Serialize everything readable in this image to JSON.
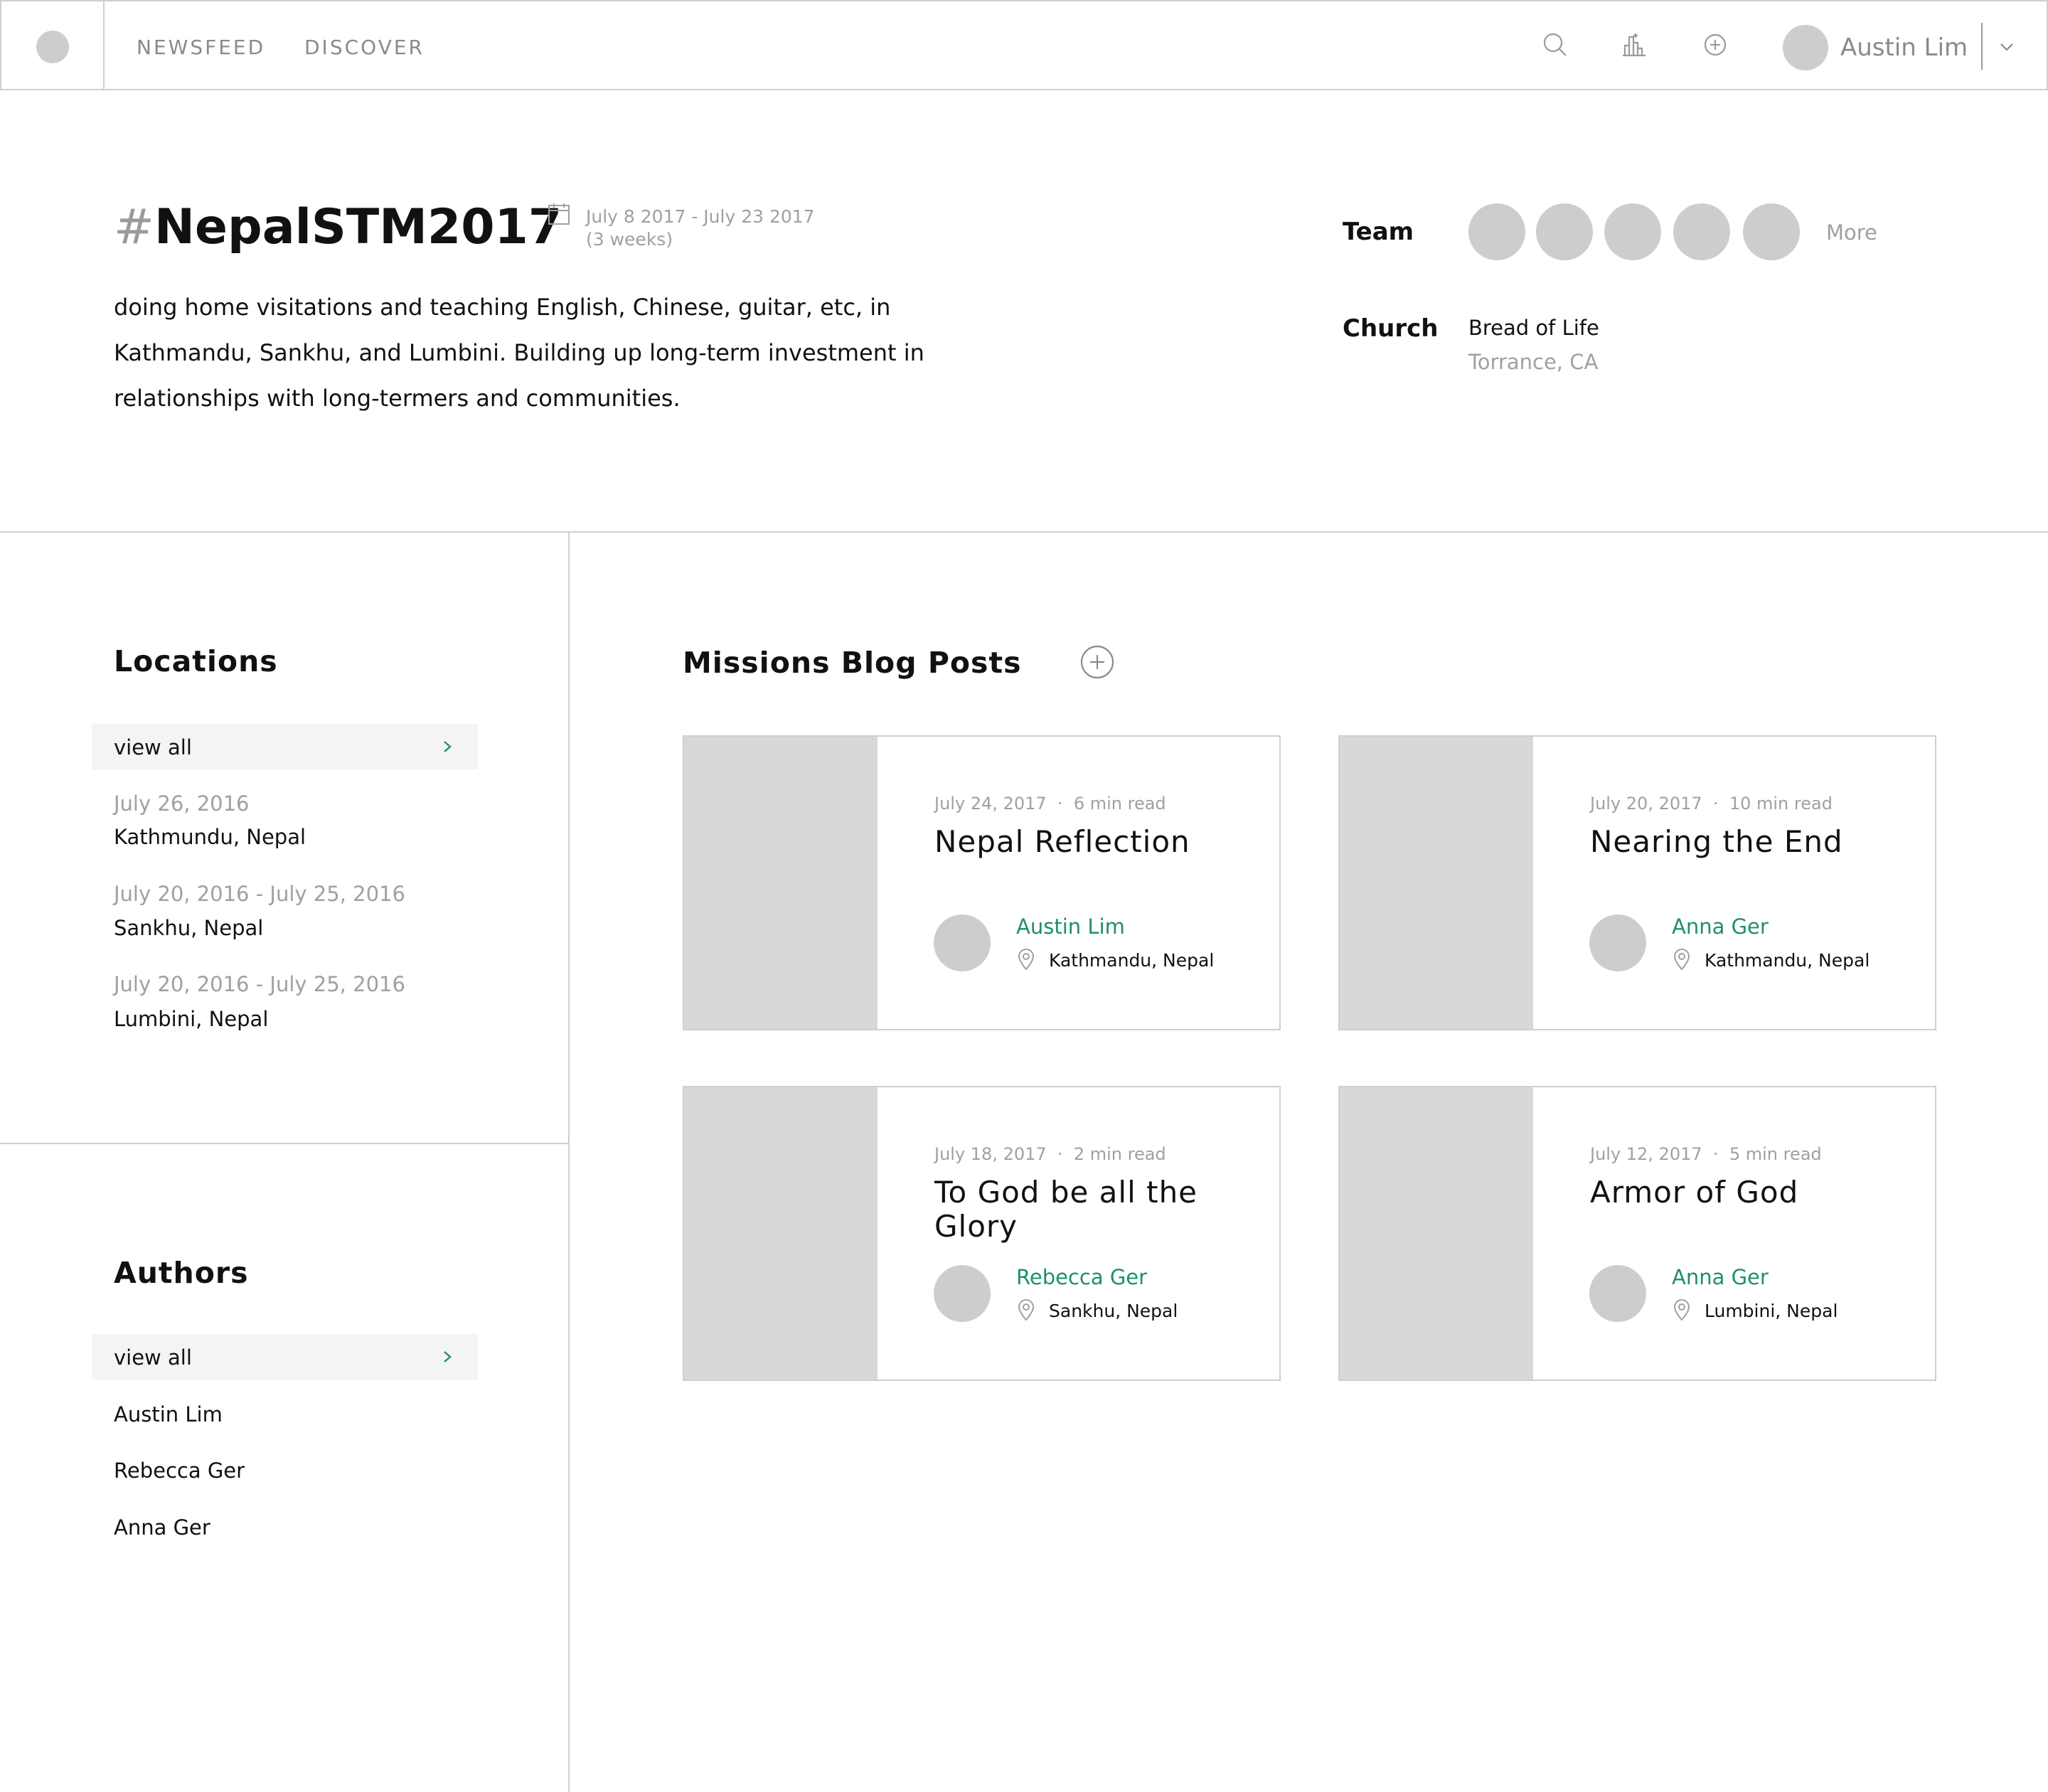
{
  "nav": {
    "links": [
      "NEWSFEED",
      "DISCOVER"
    ],
    "user_name": "Austin Lim",
    "icons": [
      "search-icon",
      "stats-icon",
      "add-icon",
      "chevron-down-icon"
    ]
  },
  "trip": {
    "hash": "#",
    "tag": "NepalSTM2017",
    "dates": "July 8 2017 - July 23 2017",
    "duration": "(3 weeks)",
    "description": "doing home visitations and teaching English, Chinese, guitar, etc, in Kathmandu, Sankhu, and Lumbini.  Building up long-term investment in relationships with long-termers and communities.",
    "team_label": "Team",
    "team_more": "More",
    "church_label": "Church",
    "church_name": "Bread of Life",
    "church_location": "Torrance, CA"
  },
  "locations": {
    "title": "Locations",
    "view_all": "view all",
    "items": [
      {
        "date": "July 26, 2016",
        "place": "Kathmundu, Nepal"
      },
      {
        "date": "July 20, 2016 - July 25, 2016",
        "place": "Sankhu, Nepal"
      },
      {
        "date": "July 20, 2016 - July 25, 2016",
        "place": "Lumbini, Nepal"
      }
    ]
  },
  "authors": {
    "title": "Authors",
    "view_all": "view all",
    "items": [
      "Austin Lim",
      "Rebecca Ger",
      "Anna Ger"
    ]
  },
  "blog": {
    "title": "Missions Blog Posts",
    "posts": [
      {
        "date": "July 24, 2017",
        "read": "6 min read",
        "title": "Nepal Reflection",
        "author": "Austin Lim",
        "location": "Kathmandu, Nepal"
      },
      {
        "date": "July 20, 2017",
        "read": "10 min read",
        "title": "Nearing the End",
        "author": "Anna Ger",
        "location": "Kathmandu, Nepal"
      },
      {
        "date": "July 18, 2017",
        "read": "2 min read",
        "title": "To God be all the Glory",
        "author": "Rebecca Ger",
        "location": "Sankhu, Nepal"
      },
      {
        "date": "July 12, 2017",
        "read": "5 min read",
        "title": "Armor of God",
        "author": "Anna Ger",
        "location": "Lumbini, Nepal"
      }
    ]
  },
  "colors": {
    "accent": "#1f8f6c",
    "muted": "#a0a0a0",
    "placeholder": "#cdcdcd"
  }
}
